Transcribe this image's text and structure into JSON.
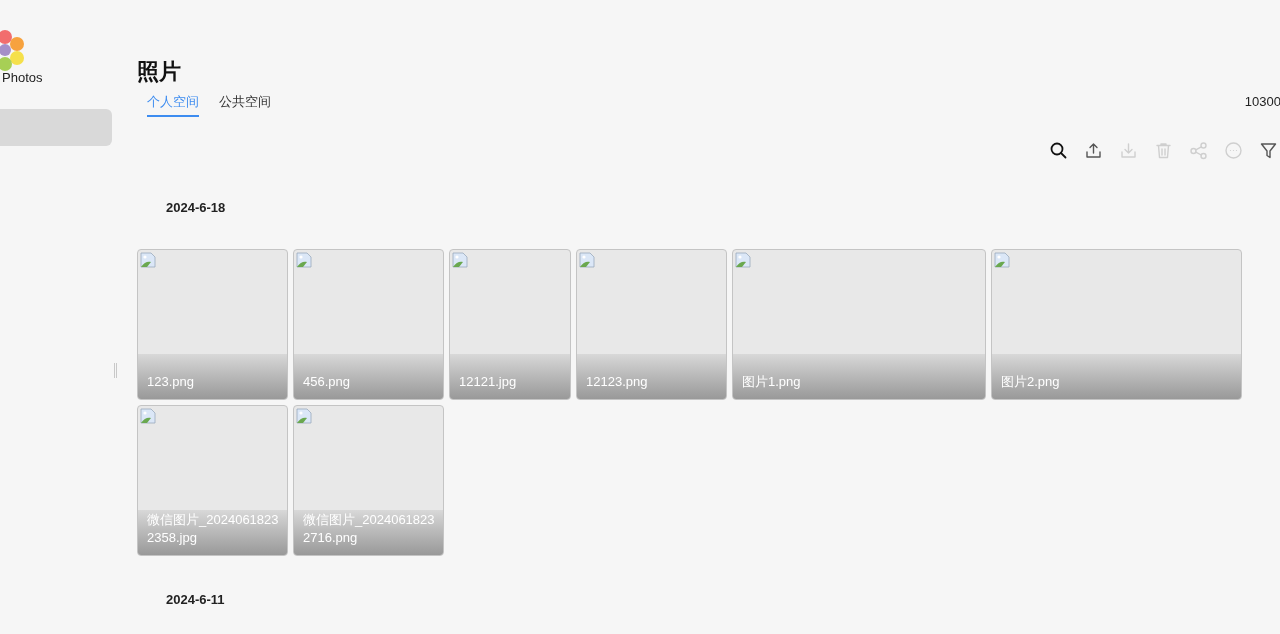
{
  "app": {
    "name": "Photos"
  },
  "page": {
    "title": "照片"
  },
  "tabs": [
    {
      "label": "个人空间",
      "selected": true
    },
    {
      "label": "公共空间",
      "selected": false
    }
  ],
  "count": "10300",
  "toolbar": [
    {
      "kind": "search",
      "disabled": false
    },
    {
      "kind": "upload",
      "disabled": false
    },
    {
      "kind": "download",
      "disabled": true
    },
    {
      "kind": "delete",
      "disabled": true
    },
    {
      "kind": "share",
      "disabled": true
    },
    {
      "kind": "more",
      "disabled": true
    },
    {
      "kind": "filter",
      "disabled": false
    }
  ],
  "groups": [
    {
      "date": "2024-6-18",
      "photos": [
        {
          "name": "123.png"
        },
        {
          "name": "456.png"
        },
        {
          "name": "12121.jpg"
        },
        {
          "name": "12123.png"
        },
        {
          "name": "图片1.png"
        },
        {
          "name": "图片2.png"
        },
        {
          "name": "微信图片_20240618232358.jpg"
        },
        {
          "name": "微信图片_20240618232716.png"
        }
      ]
    },
    {
      "date": "2024-6-11"
    }
  ]
}
